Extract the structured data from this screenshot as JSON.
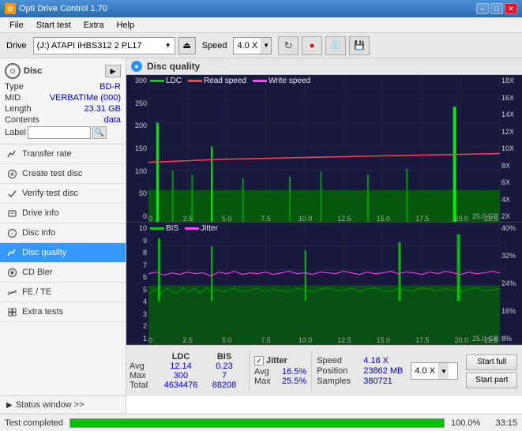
{
  "titleBar": {
    "title": "Opti Drive Control 1.70",
    "minBtn": "–",
    "maxBtn": "□",
    "closeBtn": "✕"
  },
  "menuBar": {
    "items": [
      "File",
      "Start test",
      "Extra",
      "Help"
    ]
  },
  "toolbar": {
    "driveLabel": "Drive",
    "driveValue": "(J:) ATAPI iHBS312  2 PL17",
    "speedLabel": "Speed",
    "speedValue": "4.0 X"
  },
  "disc": {
    "typeLabel": "Type",
    "typeValue": "BD-R",
    "midLabel": "MID",
    "midValue": "VERBATIMe (000)",
    "lengthLabel": "Length",
    "lengthValue": "23.31 GB",
    "contentsLabel": "Contents",
    "contentsValue": "data",
    "labelLabel": "Label",
    "labelValue": ""
  },
  "sidebar": {
    "items": [
      {
        "id": "transfer-rate",
        "label": "Transfer rate",
        "icon": "chart"
      },
      {
        "id": "create-test-disc",
        "label": "Create test disc",
        "icon": "disc"
      },
      {
        "id": "verify-test-disc",
        "label": "Verify test disc",
        "icon": "verify"
      },
      {
        "id": "drive-info",
        "label": "Drive info",
        "icon": "info"
      },
      {
        "id": "disc-info",
        "label": "Disc info",
        "icon": "disc-info"
      },
      {
        "id": "disc-quality",
        "label": "Disc quality",
        "icon": "quality",
        "active": true
      },
      {
        "id": "cd-bier",
        "label": "CD Bler",
        "icon": "cd"
      },
      {
        "id": "fe-te",
        "label": "FE / TE",
        "icon": "fe"
      },
      {
        "id": "extra-tests",
        "label": "Extra tests",
        "icon": "extra"
      }
    ],
    "statusWindow": "Status window >>"
  },
  "content": {
    "title": "Disc quality",
    "chart": {
      "topLegend": [
        {
          "label": "LDC",
          "color": "#00cc00"
        },
        {
          "label": "Read speed",
          "color": "#ff0000"
        },
        {
          "label": "Write speed",
          "color": "#ff00ff"
        }
      ],
      "bottomLegend": [
        {
          "label": "BIS",
          "color": "#00cc00"
        },
        {
          "label": "Jitter",
          "color": "#ff00ff"
        }
      ]
    }
  },
  "stats": {
    "headers": [
      "LDC",
      "BIS"
    ],
    "rows": [
      {
        "label": "Avg",
        "ldc": "12.14",
        "bis": "0.23"
      },
      {
        "label": "Max",
        "ldc": "300",
        "bis": "7"
      },
      {
        "label": "Total",
        "ldc": "4634476",
        "bis": "88208"
      }
    ],
    "jitter": {
      "checked": true,
      "label": "Jitter",
      "rows": [
        {
          "label": "Avg",
          "val": "16.5%"
        },
        {
          "label": "Max",
          "val": "25.5%"
        }
      ]
    },
    "speed": {
      "speedLabel": "Speed",
      "speedVal": "4.18 X",
      "positionLabel": "Position",
      "positionVal": "23862 MB",
      "samplesLabel": "Samples",
      "samplesVal": "380721"
    },
    "speedSelect": "4.0 X",
    "buttons": {
      "startFull": "Start full",
      "startPart": "Start part"
    }
  },
  "bottomStatus": {
    "text": "Test completed",
    "percent": "100.0%",
    "progress": 100,
    "time": "33:15"
  }
}
